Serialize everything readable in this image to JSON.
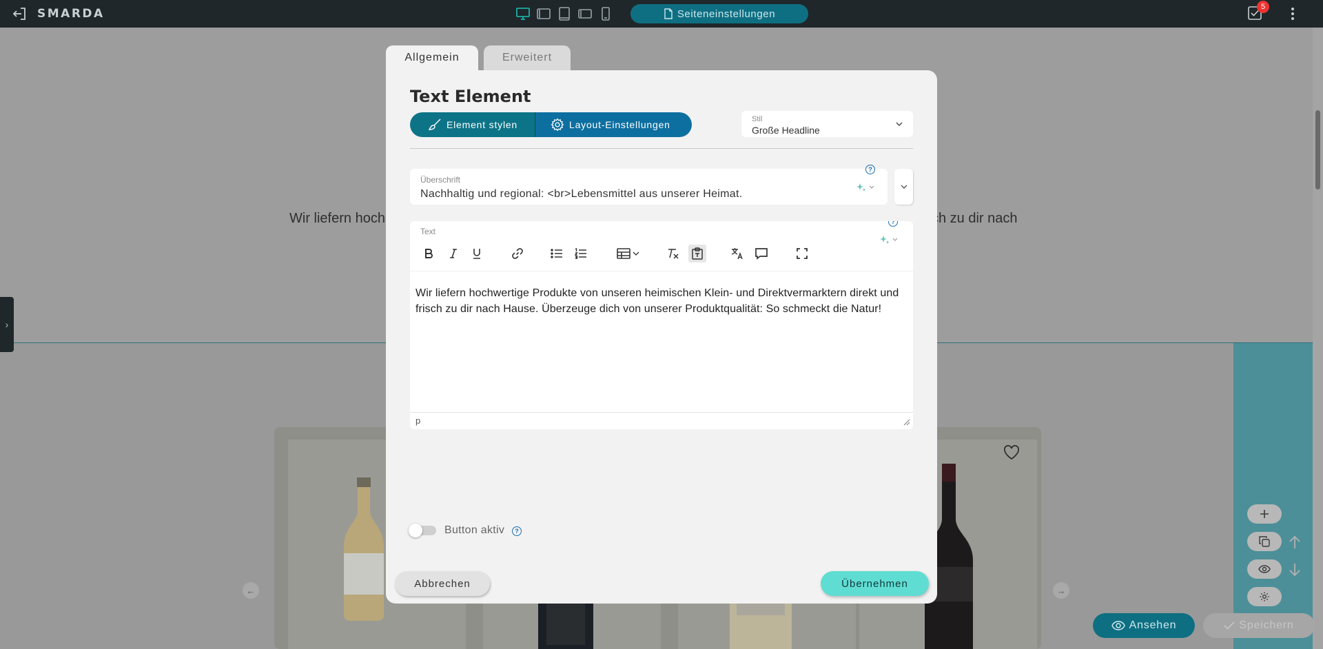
{
  "topbar": {
    "logo": "SMARDA",
    "page_settings_label": "Seiteneinstellungen",
    "tasks_badge": "5",
    "devices": [
      "desktop-icon",
      "tablet-landscape-icon",
      "tablet-portrait-icon",
      "phone-landscape-icon",
      "phone-portrait-icon"
    ],
    "active_device": "desktop-icon"
  },
  "background": {
    "text_left": "Wir liefern hoch",
    "text_right": "ch zu dir nach"
  },
  "modal": {
    "tabs": [
      {
        "label": "Allgemein",
        "active": true
      },
      {
        "label": "Erweitert",
        "active": false
      }
    ],
    "title": "Text Element",
    "segment": {
      "style_label": "Element stylen",
      "layout_label": "Layout-Einstellungen"
    },
    "stil": {
      "label": "Stil",
      "value": "Große Headline"
    },
    "heading_field": {
      "label": "Überschrift",
      "value": "Nachhaltig und regional: <br>Lebensmittel aus unserer Heimat."
    },
    "text_field": {
      "label": "Text",
      "content": "Wir liefern hochwertige Produkte von unseren heimischen Klein- und Direktvermarktern direkt und frisch zu dir nach Hause. Überzeuge dich von unserer Produktqualität: So schmeckt die Natur!",
      "status_path": "p"
    },
    "button_toggle": {
      "label": "Button aktiv",
      "enabled": false
    },
    "cancel_label": "Abbrechen",
    "apply_label": "Übernehmen"
  },
  "page_actions": {
    "view_label": "Ansehen",
    "save_label": "Speichern"
  },
  "colors": {
    "topbar": "#1f272a",
    "accent_teal": "#0d7487",
    "accent_blue": "#0d6fa0",
    "apply": "#60ddd3",
    "device_active": "#18c3b7"
  }
}
